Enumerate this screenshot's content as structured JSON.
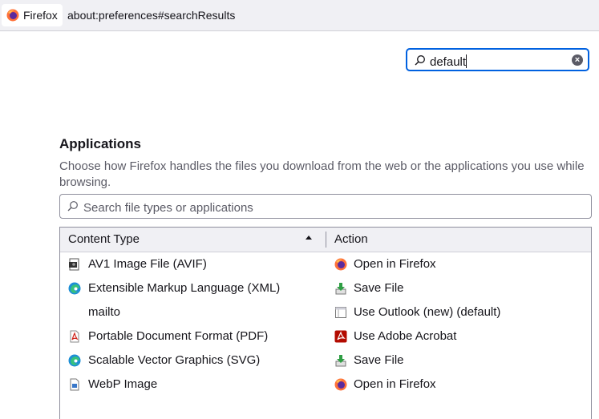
{
  "browser": {
    "identity_label": "Firefox",
    "url": "about:preferences#searchResults"
  },
  "pref_search": {
    "value": "default"
  },
  "applications": {
    "heading": "Applications",
    "description": "Choose how Firefox handles the files you download from the web or the applications you use while browsing.",
    "filter_placeholder": "Search file types or applications",
    "columns": {
      "content_type": "Content Type",
      "action": "Action"
    },
    "rows": [
      {
        "type": "AV1 Image File (AVIF)",
        "type_icon": "avif-file-icon",
        "action": "Open in Firefox",
        "action_icon": "firefox-icon"
      },
      {
        "type": "Extensible Markup Language (XML)",
        "type_icon": "edge-icon",
        "action": "Save File",
        "action_icon": "save-file-icon"
      },
      {
        "type": "mailto",
        "type_icon": "",
        "action": "Use Outlook (new) (default)",
        "action_icon": "outlook-window-icon"
      },
      {
        "type": "Portable Document Format (PDF)",
        "type_icon": "pdf-file-icon",
        "action": "Use Adobe Acrobat",
        "action_icon": "acrobat-icon"
      },
      {
        "type": "Scalable Vector Graphics (SVG)",
        "type_icon": "edge-icon",
        "action": "Save File",
        "action_icon": "save-file-icon"
      },
      {
        "type": "WebP Image",
        "type_icon": "image-file-icon",
        "action": "Open in Firefox",
        "action_icon": "firefox-icon"
      }
    ]
  },
  "colors": {
    "accent": "#0061e0",
    "text": "#15141a",
    "secondary_text": "#5b5b66",
    "header_bg": "#f0f0f4"
  }
}
